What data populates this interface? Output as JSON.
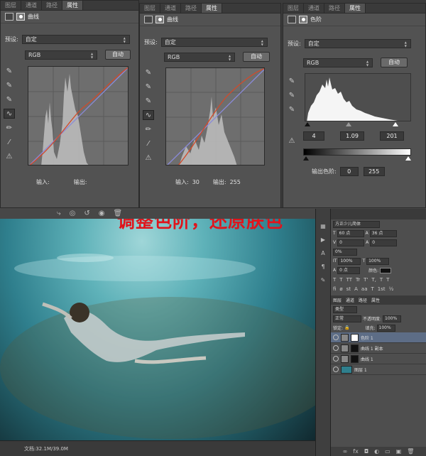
{
  "panels": [
    {
      "tabs": [
        "图层",
        "通道",
        "路径",
        "属性"
      ],
      "active_tab": 3,
      "title": "曲线",
      "preset_label": "预设:",
      "preset_value": "自定",
      "channel": "RGB",
      "auto_label": "自动",
      "input_label": "输入:",
      "output_label": "输出:",
      "input_value": "",
      "output_value": ""
    },
    {
      "tabs": [
        "图层",
        "通道",
        "路径",
        "属性"
      ],
      "active_tab": 3,
      "title": "曲线",
      "preset_label": "预设:",
      "preset_value": "自定",
      "channel": "RGB",
      "auto_label": "自动",
      "input_label": "输入:",
      "output_label": "输出:",
      "input_value": "30",
      "output_value": "255"
    },
    {
      "tabs": [
        "图层",
        "通道",
        "路径",
        "属性"
      ],
      "active_tab": 3,
      "title": "色阶",
      "preset_label": "预设:",
      "preset_value": "自定",
      "channel": "RGB",
      "auto_label": "自动",
      "levels": [
        "4",
        "1.09",
        "201"
      ],
      "output_levels_label": "输出色阶:",
      "output_levels": [
        "0",
        "255"
      ]
    }
  ],
  "overlay_text": "调整色阶，还原肤色",
  "status": {
    "doc": "文档:32.1M/39.0M"
  },
  "right_panel": {
    "font": "方正少儿简体",
    "size1": "60 点",
    "size2": "36 点",
    "kern": "0",
    "track": "0",
    "pct": "0%",
    "scale1": "100%",
    "scale2": "100%",
    "baseline": "0 点",
    "color_label": "颜色:",
    "tabs": [
      "图层",
      "通道",
      "路径",
      "属性"
    ],
    "kind_label": "类型",
    "blend": "正常",
    "opacity_label": "不透明度:",
    "opacity": "100%",
    "lock_label": "锁定:",
    "fill_label": "填充:",
    "fill": "100%",
    "layers": [
      {
        "name": "色阶 1",
        "selected": true
      },
      {
        "name": "曲线 1 副本",
        "selected": false
      },
      {
        "name": "曲线 1",
        "selected": false
      },
      {
        "name": "图层 1",
        "selected": false
      }
    ]
  }
}
